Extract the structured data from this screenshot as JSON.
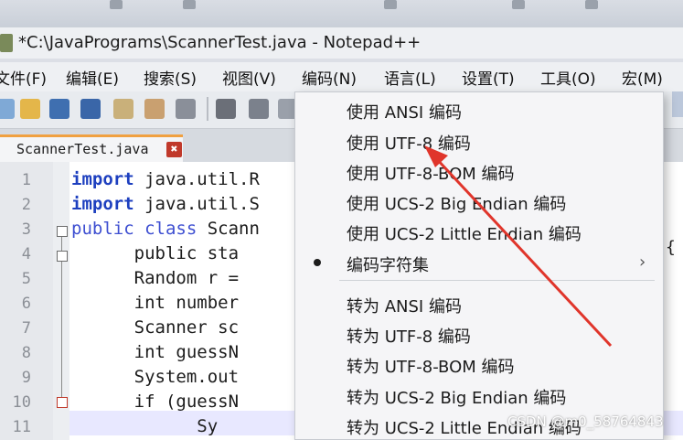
{
  "window": {
    "title": "*C:\\JavaPrograms\\ScannerTest.java - Notepad++"
  },
  "menubar": {
    "items": [
      "文件(F)",
      "编辑(E)",
      "搜索(S)",
      "视图(V)",
      "编码(N)",
      "语言(L)",
      "设置(T)",
      "工具(O)",
      "宏(M)"
    ]
  },
  "tab": {
    "label": "ScannerTest.java",
    "close": "✖"
  },
  "editor": {
    "line_numbers": [
      "1",
      "2",
      "3",
      "4",
      "5",
      "6",
      "7",
      "8",
      "9",
      "10",
      "11"
    ],
    "lines": [
      {
        "kw": "import",
        "rest": " java.util.R"
      },
      {
        "kw": "import",
        "rest": " java.util.S"
      },
      {
        "kw": "public class",
        "rest": " Scann"
      },
      {
        "kw": "",
        "rest": "      public sta"
      },
      {
        "kw": "",
        "rest": "      Random r ="
      },
      {
        "kw": "",
        "rest": "      int number"
      },
      {
        "kw": "",
        "rest": "      Scanner sc"
      },
      {
        "kw": "",
        "rest": "      int guessN"
      },
      {
        "kw": "",
        "rest": "      System.out"
      },
      {
        "kw": "",
        "rest": "      if (guessN"
      },
      {
        "kw": "",
        "rest": "            Sy"
      }
    ],
    "right_brace": "{"
  },
  "encoding_menu": {
    "items": [
      "使用 ANSI 编码",
      "使用 UTF-8 编码",
      "使用 UTF-8-BOM 编码",
      "使用 UCS-2 Big Endian 编码",
      "使用 UCS-2 Little Endian 编码",
      "编码字符集",
      "转为 ANSI 编码",
      "转为 UTF-8 编码",
      "转为 UTF-8-BOM 编码",
      "转为 UCS-2 Big Endian 编码",
      "转为 UCS-2 Little Endian 编码"
    ],
    "submenu_arrow": "›"
  },
  "watermark": "CSDN @m0_58764843",
  "colors": {
    "keyword": "#1d3fbf",
    "annotation_arrow": "#e0352b",
    "tab_accent": "#f0a040"
  }
}
